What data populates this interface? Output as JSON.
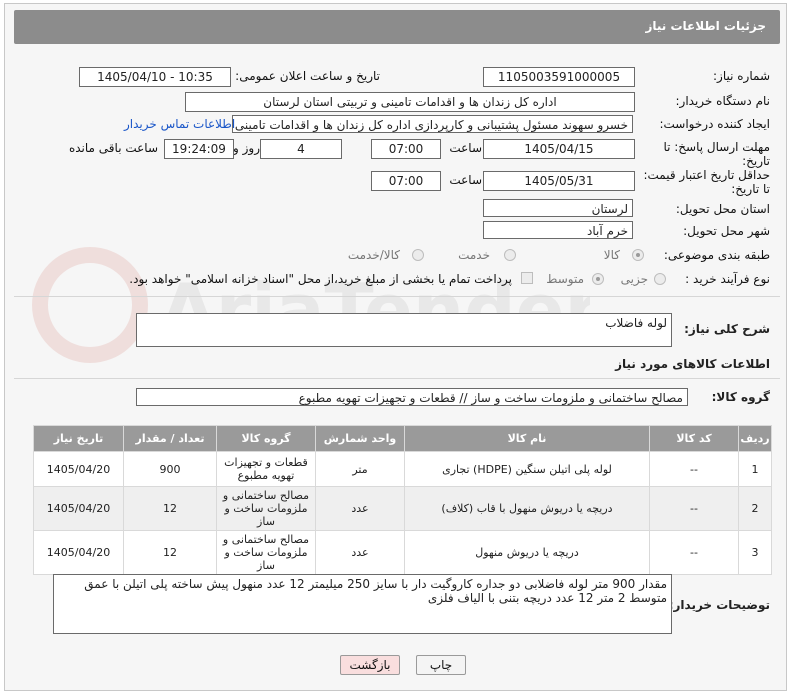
{
  "header": {
    "title": "جزئیات اطلاعات نیاز"
  },
  "form": {
    "need_number_label": "شماره نیاز:",
    "need_number": "1105003591000005",
    "announce_label": "تاریخ و ساعت اعلان عمومی:",
    "announce_value": "1405/04/10 - 10:35",
    "buyer_org_label": "نام دستگاه خریدار:",
    "buyer_org": "اداره کل زندان ها و اقدامات تامینی و تربیتی استان لرستان",
    "creator_label": "ایجاد کننده درخواست:",
    "creator": "خسرو سهوند مسئول پشتیبانی و کارپردازی اداره کل زندان ها و اقدامات تامینی",
    "contact_link": "اطلاعات تماس خریدار",
    "deadline_label": "مهلت ارسال پاسخ: تا تاریخ:",
    "deadline_date": "1405/04/15",
    "time_label": "ساعت",
    "deadline_time": "07:00",
    "days_value": "4",
    "days_label": "روز و",
    "remaining_time": "19:24:09",
    "remaining_label": "ساعت باقی مانده",
    "price_validity_label": "حداقل تاریخ اعتبار قیمت: تا تاریخ:",
    "price_date": "1405/05/31",
    "price_time": "07:00",
    "province_label": "استان محل تحویل:",
    "province": "لرستان",
    "city_label": "شهر محل تحویل:",
    "city": "خرم آباد",
    "category_label": "طبقه بندی موضوعی:",
    "category_options": [
      "کالا",
      "خدمت",
      "کالا/خدمت"
    ],
    "process_label": "نوع فرآیند خرید :",
    "process_options": [
      "جزیی",
      "متوسط"
    ],
    "payment_note": "پرداخت تمام یا بخشی از مبلغ خرید،از محل \"اسناد خزانه اسلامی\" خواهد بود."
  },
  "description": {
    "label": "شرح کلی نیاز:",
    "value": "لوله فاضلاب"
  },
  "goods": {
    "section_title": "اطلاعات کالاهای مورد نیاز",
    "group_label": "گروه کالا:",
    "group_value": "مصالح ساختمانی و ملزومات ساخت و ساز //  قطعات و تجهیزات تهویه مطبوع",
    "columns": [
      "ردیف",
      "کد کالا",
      "نام کالا",
      "واحد شمارش",
      "گروه کالا",
      "تعداد / مقدار",
      "تاریخ نیاز"
    ],
    "rows": [
      {
        "idx": "1",
        "code": "--",
        "name": "لوله پلی اتیلن سنگین (HDPE) تجاری",
        "unit": "متر",
        "group": "قطعات و تجهیزات تهویه مطبوع",
        "qty": "900",
        "date": "1405/04/20"
      },
      {
        "idx": "2",
        "code": "--",
        "name": "دریچه یا دریوش منهول با قاب (کلاف)",
        "unit": "عدد",
        "group": "مصالح ساختمانی و ملزومات ساخت و ساز",
        "qty": "12",
        "date": "1405/04/20"
      },
      {
        "idx": "3",
        "code": "--",
        "name": "دریچه یا دریوش منهول",
        "unit": "عدد",
        "group": "مصالح ساختمانی و ملزومات ساخت و ساز",
        "qty": "12",
        "date": "1405/04/20"
      }
    ]
  },
  "buyer_notes": {
    "label": "توضیحات خریدار:",
    "value": "مقدار 900 متر لوله فاضلابی دو جداره کاروگیت دار با سایز 250 میلیمتر 12 عدد منهول پیش ساخته پلی اتیلن  با عمق متوسط 2 متر 12 عدد دریچه بتنی با الیاف فلزی"
  },
  "buttons": {
    "print": "چاپ",
    "back": "بازگشت"
  },
  "watermark_text": "AriaTender.neT"
}
